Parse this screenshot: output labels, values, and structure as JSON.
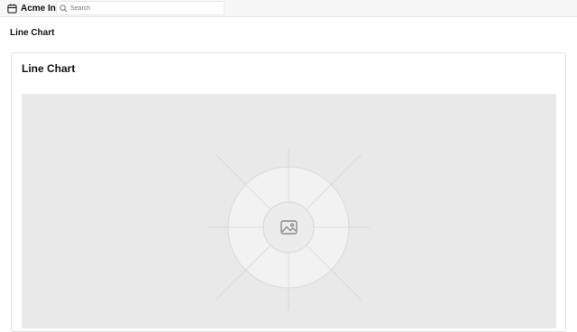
{
  "header": {
    "app_name": "Acme Inc",
    "logo_icon": "package-icon",
    "search": {
      "placeholder": "Search",
      "value": "",
      "icon": "search-icon"
    }
  },
  "page": {
    "title": "Line Chart"
  },
  "card": {
    "title": "Line Chart",
    "image_placeholder_icon": "image-icon"
  },
  "colors": {
    "topbar_bg": "#f7f7f7",
    "placeholder_bg": "#e9e9e9",
    "border": "#e2e2e2"
  }
}
